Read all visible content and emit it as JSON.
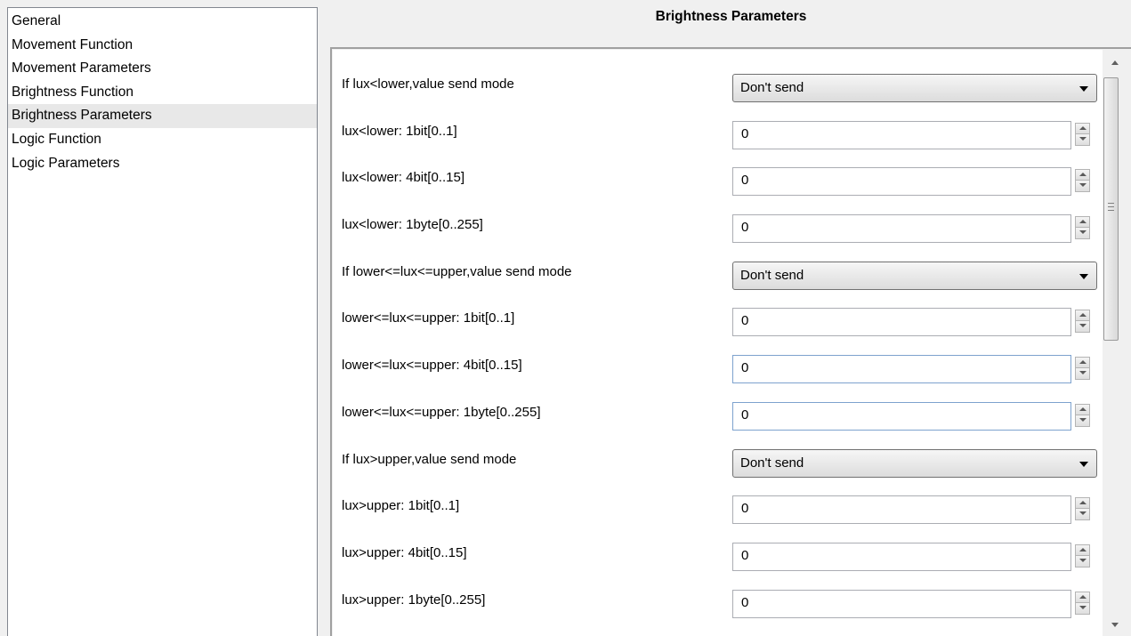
{
  "nav": {
    "items": [
      {
        "label": "General",
        "selected": false
      },
      {
        "label": "Movement Function",
        "selected": false
      },
      {
        "label": "Movement Parameters",
        "selected": false
      },
      {
        "label": "Brightness Function",
        "selected": false
      },
      {
        "label": "Brightness Parameters",
        "selected": true
      },
      {
        "label": "Logic Function",
        "selected": false
      },
      {
        "label": "Logic Parameters",
        "selected": false
      }
    ]
  },
  "panel": {
    "title": "Brightness Parameters",
    "rows": [
      {
        "label": "If lux<lower,value send mode",
        "type": "select",
        "value": "Don't send"
      },
      {
        "label": "lux<lower: 1bit[0..1]",
        "type": "spin",
        "value": "0"
      },
      {
        "label": "lux<lower: 4bit[0..15]",
        "type": "spin",
        "value": "0"
      },
      {
        "label": "lux<lower: 1byte[0..255]",
        "type": "spin",
        "value": "0"
      },
      {
        "label": "If lower<=lux<=upper,value send mode",
        "type": "select",
        "value": "Don't send"
      },
      {
        "label": "lower<=lux<=upper: 1bit[0..1]",
        "type": "spin",
        "value": "0"
      },
      {
        "label": "lower<=lux<=upper: 4bit[0..15]",
        "type": "spin",
        "value": "0",
        "focused": true
      },
      {
        "label": "lower<=lux<=upper: 1byte[0..255]",
        "type": "spin",
        "value": "0",
        "focused": true
      },
      {
        "label": "If lux>upper,value send mode",
        "type": "select",
        "value": "Don't send"
      },
      {
        "label": "lux>upper: 1bit[0..1]",
        "type": "spin",
        "value": "0"
      },
      {
        "label": "lux>upper: 4bit[0..15]",
        "type": "spin",
        "value": "0"
      },
      {
        "label": "lux>upper: 1byte[0..255]",
        "type": "spin",
        "value": "0"
      }
    ]
  },
  "scrollbar": {
    "position_fraction": 0.0,
    "visible_fraction": 0.46
  },
  "icons": [
    "chevron-down-icon",
    "spin-up-icon",
    "spin-down-icon",
    "scroll-up-icon",
    "scroll-down-icon"
  ]
}
